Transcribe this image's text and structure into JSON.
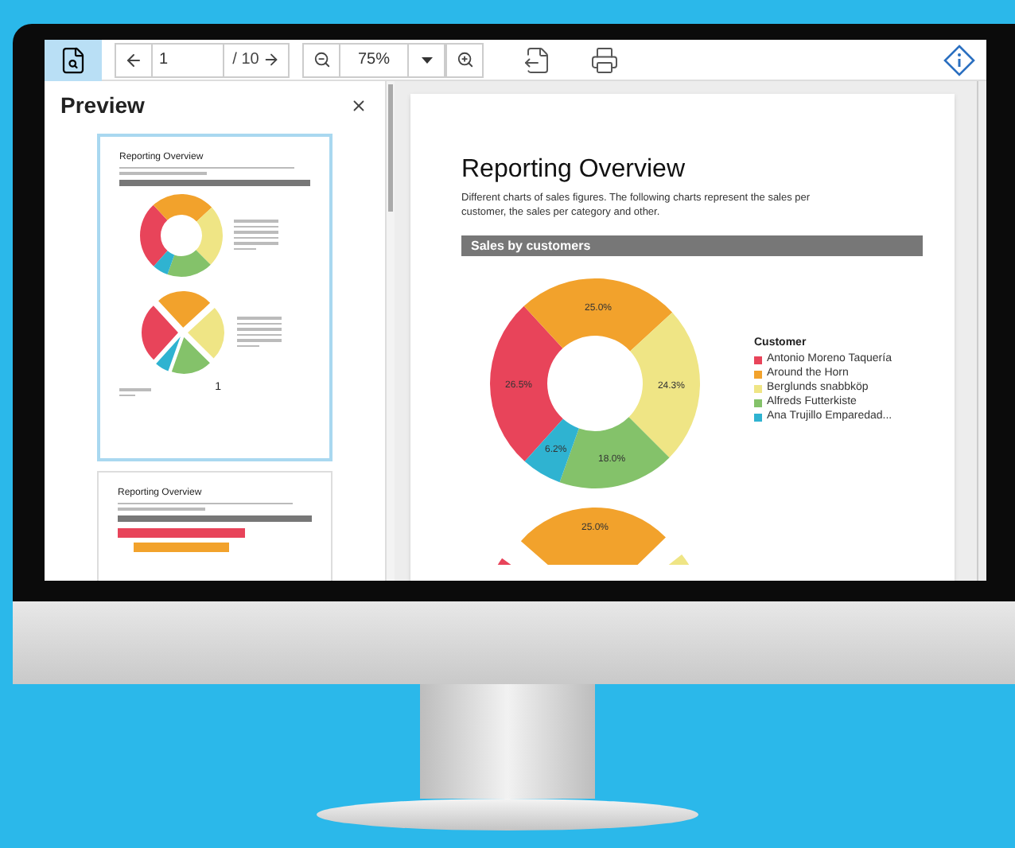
{
  "toolbar": {
    "preview_toggle": {
      "selected": true
    },
    "page_field": {
      "value": "1"
    },
    "page_total": "/ 10",
    "zoom_field": {
      "value": "75%"
    }
  },
  "sidebar": {
    "title": "Preview",
    "thumbnails": [
      {
        "title": "Reporting Overview",
        "page_number": "1",
        "selected": true
      },
      {
        "title": "Reporting Overview",
        "selected": false
      }
    ]
  },
  "page": {
    "title": "Reporting Overview",
    "description": "Different charts of sales figures. The following charts represent the sales per customer, the sales per category and other.",
    "section_heading": "Sales by customers",
    "chart_data": {
      "type": "donut",
      "categories": [
        "Antonio Moreno Taquería",
        "Around the Horn",
        "Berglunds snabbköp",
        "Alfreds Futterkiste",
        "Ana Trujillo Emparedad..."
      ],
      "series": [
        {
          "name": "Customer",
          "values": [
            26.5,
            25.0,
            24.3,
            18.0,
            6.2
          ]
        }
      ],
      "colors": [
        "#e8445a",
        "#f2a22c",
        "#efe585",
        "#84c26a",
        "#2fb3d1"
      ],
      "value_labels": [
        "26.5%",
        "25.0%",
        "24.3%",
        "18.0%",
        "6.2%"
      ]
    },
    "second_chart_label": "25.0%"
  }
}
